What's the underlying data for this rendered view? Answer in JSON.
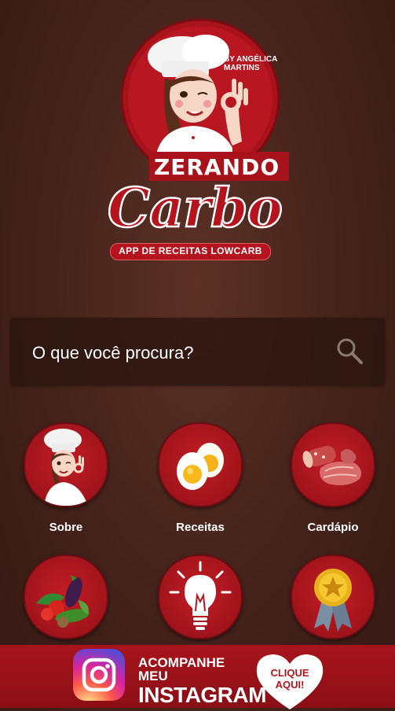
{
  "logo": {
    "by_text": "BY ANGÉLICA MARTINS",
    "title_top": "ZERANDO",
    "title_main": "Carbo",
    "subtitle": "APP DE RECEITAS LOWCARB"
  },
  "search": {
    "placeholder": "O que você procura?",
    "icon": "search-icon"
  },
  "menu": {
    "items": [
      {
        "label": "Sobre",
        "icon": "chef-icon"
      },
      {
        "label": "Receitas",
        "icon": "eggs-icon"
      },
      {
        "label": "Cardápio",
        "icon": "meat-icon"
      },
      {
        "label": "",
        "icon": "vegetables-icon"
      },
      {
        "label": "",
        "icon": "lightbulb-icon"
      },
      {
        "label": "",
        "icon": "award-ribbon-icon"
      }
    ]
  },
  "banner": {
    "line1": "ACOMPANHE MEU",
    "line2": "INSTAGRAM",
    "heart_line1": "CLIQUE",
    "heart_line2": "AQUI!",
    "icon": "instagram-icon"
  },
  "colors": {
    "background": "#43221a",
    "accent_red": "#b5141e",
    "text": "#ffffff"
  }
}
